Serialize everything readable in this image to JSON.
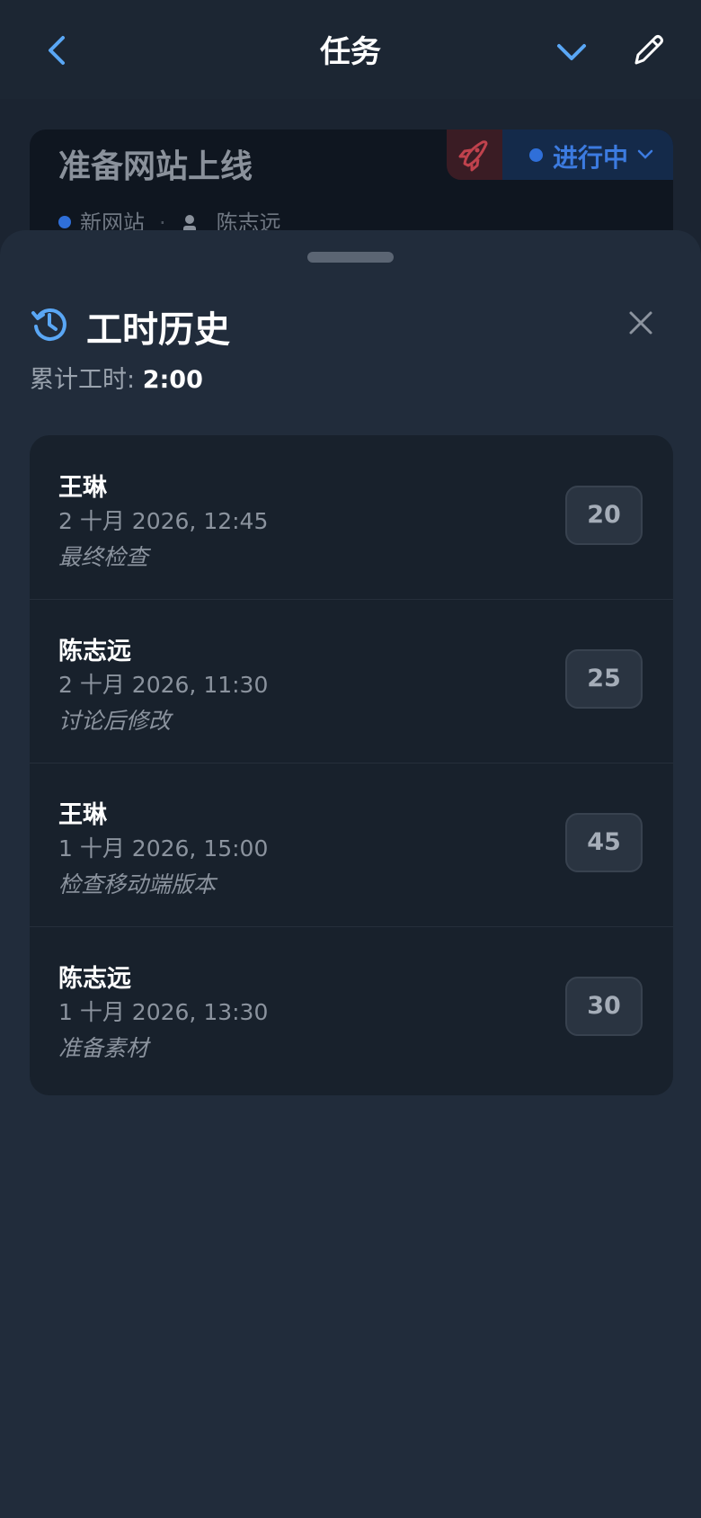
{
  "nav": {
    "title": "任务",
    "back_icon": "chevron-left-icon",
    "collapse_icon": "chevron-down-icon",
    "edit_icon": "pencil-icon",
    "accent": "#5aa7f5"
  },
  "task": {
    "title": "准备网站上线",
    "status": "进行中",
    "project": "新网站",
    "assignee": "陈志远",
    "rocket_icon": "rocket-icon"
  },
  "sheet": {
    "title": "工时历史",
    "total_label": "累计工时:",
    "total_value": "2:00",
    "history_icon": "history-icon",
    "close_icon": "close-icon"
  },
  "entries": [
    {
      "name": "王琳",
      "time": "2 十月 2026, 12:45",
      "note": "最终检查",
      "minutes": "20"
    },
    {
      "name": "陈志远",
      "time": "2 十月 2026, 11:30",
      "note": "讨论后修改",
      "minutes": "25"
    },
    {
      "name": "王琳",
      "time": "1 十月 2026, 15:00",
      "note": "检查移动端版本",
      "minutes": "45"
    },
    {
      "name": "陈志远",
      "time": "1 十月 2026, 13:30",
      "note": "准备素材",
      "minutes": "30"
    }
  ]
}
